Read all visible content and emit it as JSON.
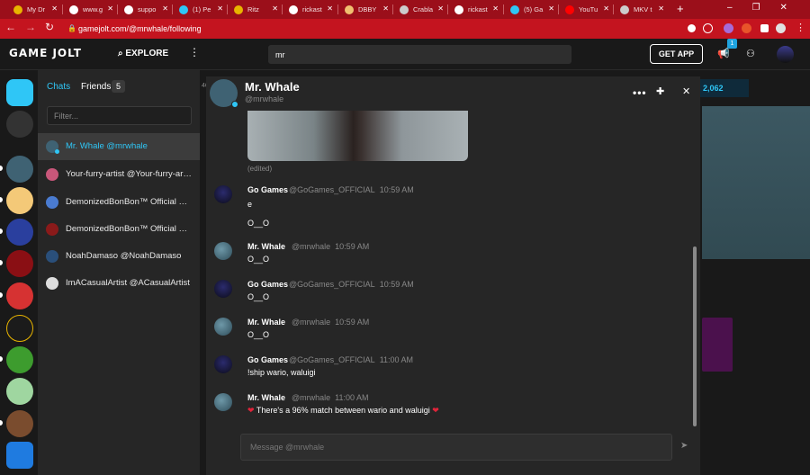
{
  "browser": {
    "tabs": [
      {
        "label": "My Dr",
        "fav": "#e8b400"
      },
      {
        "label": "www.g",
        "fav": "#ffffff"
      },
      {
        "label": "suppo",
        "fav": "#ffffff"
      },
      {
        "label": "(1) Pe",
        "fav": "#2fc6f6"
      },
      {
        "label": "Ritz",
        "fav": "#e8b400"
      },
      {
        "label": "rickast",
        "fav": "#ffffff"
      },
      {
        "label": "DBBY",
        "fav": "#f0c070"
      },
      {
        "label": "Crabla",
        "fav": "#cccccc"
      },
      {
        "label": "rickast",
        "fav": "#ffffff"
      },
      {
        "label": "(5) Ga",
        "fav": "#2fc6f6"
      },
      {
        "label": "YouTu",
        "fav": "#ff0000"
      },
      {
        "label": "MKV t",
        "fav": "#cccccc"
      }
    ],
    "new_tab": "+",
    "back": "←",
    "forward": "→",
    "reload": "↻",
    "url": "gamejolt.com/@mrwhale/following",
    "win": {
      "min": "‒",
      "max": "❐",
      "close": "✕"
    },
    "colors": {
      "tabstrip": "#9b0f1a",
      "toolbar": "#c4141f"
    }
  },
  "gj": {
    "logo": "GAME JOLT",
    "explore": "EXPLORE",
    "more": "⋮",
    "search_value": "mr",
    "get_app": "GET APP",
    "notif_count": "1",
    "accent": "#2fc6f6"
  },
  "chat_panel": {
    "chats_tab": "Chats",
    "friends_tab": "Friends",
    "friends_count": "5",
    "filter_placeholder": "Filter...",
    "friends": [
      {
        "label": "Mr. Whale @mrwhale",
        "selected": true
      },
      {
        "label": "Your-furry-artist @Your-furry-artist"
      },
      {
        "label": "DemonizedBonBon™ Official #IndieMaker"
      },
      {
        "label": "DemonizedBonBon™ Official #IndieMaker"
      },
      {
        "label": "NoahDamaso @NoahDamaso"
      },
      {
        "label": "ImACasualArtist @ACasualArtist"
      }
    ]
  },
  "background": {
    "stat": "2,062",
    "num": "46"
  },
  "chat": {
    "name": "Mr. Whale",
    "username": "@mrwhale",
    "more": "•••",
    "add": "✚",
    "close": "✕",
    "edited": "(edited)",
    "messages": [
      {
        "name": "Go Games",
        "handle": "@GoGames_OFFICIAL",
        "time": "10:59 AM",
        "lines": [
          "e",
          "O__O"
        ],
        "avatar": "gogames"
      },
      {
        "name": "Mr. Whale",
        "handle": "@mrwhale",
        "time": "10:59 AM",
        "lines": [
          "O__O"
        ],
        "avatar": "whale"
      },
      {
        "name": "Go Games",
        "handle": "@GoGames_OFFICIAL",
        "time": "10:59 AM",
        "lines": [
          "O__O"
        ],
        "avatar": "gogames"
      },
      {
        "name": "Mr. Whale",
        "handle": "@mrwhale",
        "time": "10:59 AM",
        "lines": [
          "O__O"
        ],
        "avatar": "whale"
      },
      {
        "name": "Go Games",
        "handle": "@GoGames_OFFICIAL",
        "time": "11:00 AM",
        "lines": [
          "!ship wario, waluigi"
        ],
        "avatar": "gogames"
      },
      {
        "name": "Mr. Whale",
        "handle": "@mrwhale",
        "time": "11:00 AM",
        "lines": [
          "There's a 96% match between wario and waluigi"
        ],
        "avatar": "whale",
        "hearts": true
      }
    ],
    "heart": "❤",
    "composer_placeholder": "Message @mrwhale",
    "send": "➤"
  }
}
